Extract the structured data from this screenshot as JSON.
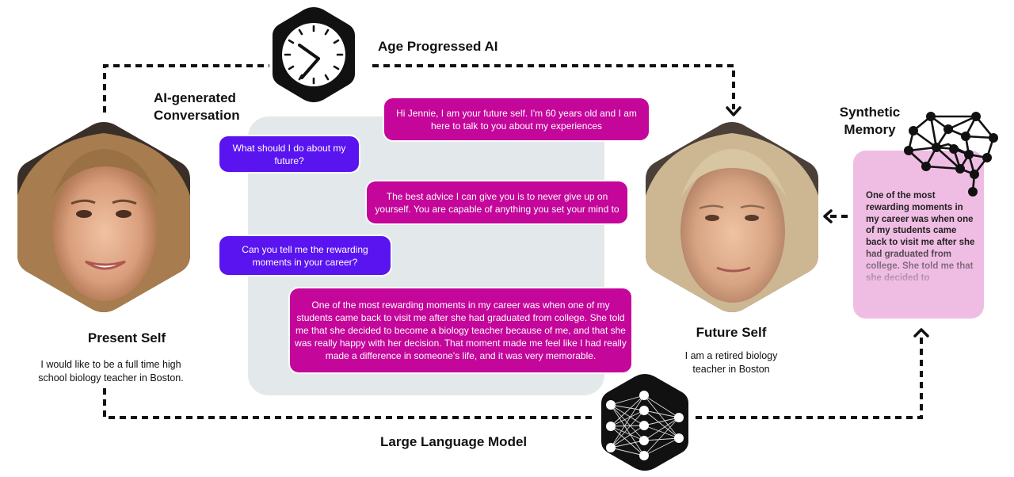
{
  "title_labels": {
    "age_progressed": "Age Progressed AI",
    "conversation_line1": "AI-generated",
    "conversation_line2": "Conversation",
    "synthetic_line1": "Synthetic",
    "synthetic_line2": "Memory",
    "llm": "Large Language Model"
  },
  "present_self": {
    "title": "Present Self",
    "description_line1": "I would like to be a full time high",
    "description_line2": "school biology teacher in Boston."
  },
  "future_self": {
    "title": "Future Self",
    "description_line1": "I am a retired biology",
    "description_line2": "teacher in Boston"
  },
  "conversation": [
    {
      "role": "ai",
      "text": "Hi Jennie, I am your future self. I'm 60 years old and I am here to talk to you about my experiences"
    },
    {
      "role": "user",
      "text": "What should I do about my future?"
    },
    {
      "role": "ai",
      "text": "The best advice I can give you is to never give up on yourself. You are capable of anything you set your mind to"
    },
    {
      "role": "user",
      "text": "Can you tell me the rewarding moments in your career?"
    },
    {
      "role": "ai",
      "text": "One of the most rewarding moments in my career was when one of my students came back to visit me after she had graduated from college. She told me that she decided to become a biology teacher because of me, and that she was really happy with her decision. That moment made me feel like I had really made a difference in someone's life, and it was very memorable."
    }
  ],
  "synthetic_memory": {
    "text": "One of the most rewarding moments in my career was when one of my students came back to visit me after she had graduated from college. She told me that she decided to"
  },
  "icons": {
    "clock": "clock-icon",
    "neural_network": "neural-network-icon",
    "brain_network": "brain-network-icon"
  },
  "colors": {
    "user_bubble": "#5a14f0",
    "ai_bubble": "#c4069a",
    "panel": "#e3e9eb",
    "memory_card": "#efbde3"
  }
}
